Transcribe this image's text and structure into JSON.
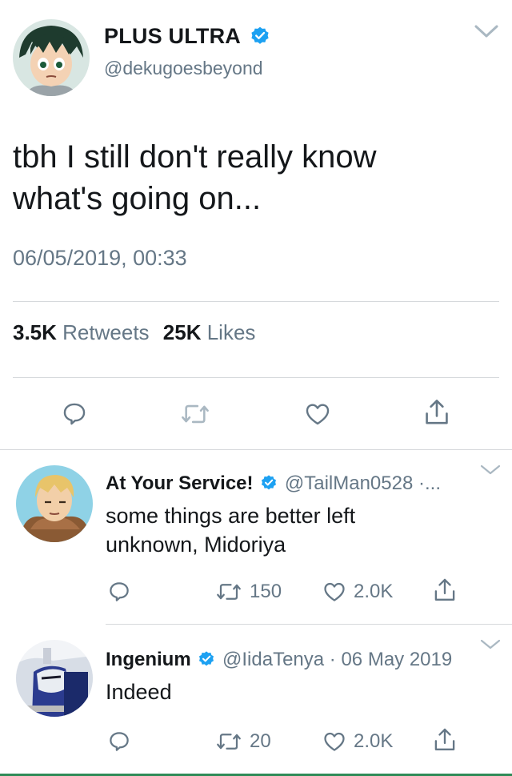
{
  "main_tweet": {
    "name": "PLUS ULTRA",
    "handle": "@dekugoesbeyond",
    "text_line1": "tbh I still don't really know",
    "text_line2": "what's going on...",
    "timestamp": "06/05/2019, 00:33",
    "retweet_count": "3.5K",
    "retweet_label": "Retweets",
    "like_count": "25K",
    "like_label": "Likes"
  },
  "replies": [
    {
      "name": "At Your Service!",
      "handle": "@TailMan0528",
      "meta": "·...",
      "text_line1": "some things are better left",
      "text_line2": "unknown, Midoriya",
      "retweets": "150",
      "likes": "2.0K"
    },
    {
      "name": "Ingenium",
      "handle": "@IidaTenya",
      "meta": "· 06 May 2019",
      "text_line1": "Indeed",
      "retweets": "20",
      "likes": "2.0K"
    }
  ],
  "colors": {
    "verified_blue": "#1da1f2",
    "secondary_text": "#657786",
    "icon_gray": "#657786",
    "divider": "#d6d9dc"
  },
  "icons": [
    "verified-badge-icon",
    "chevron-down-icon",
    "reply-icon",
    "retweet-icon",
    "like-icon",
    "share-icon"
  ]
}
